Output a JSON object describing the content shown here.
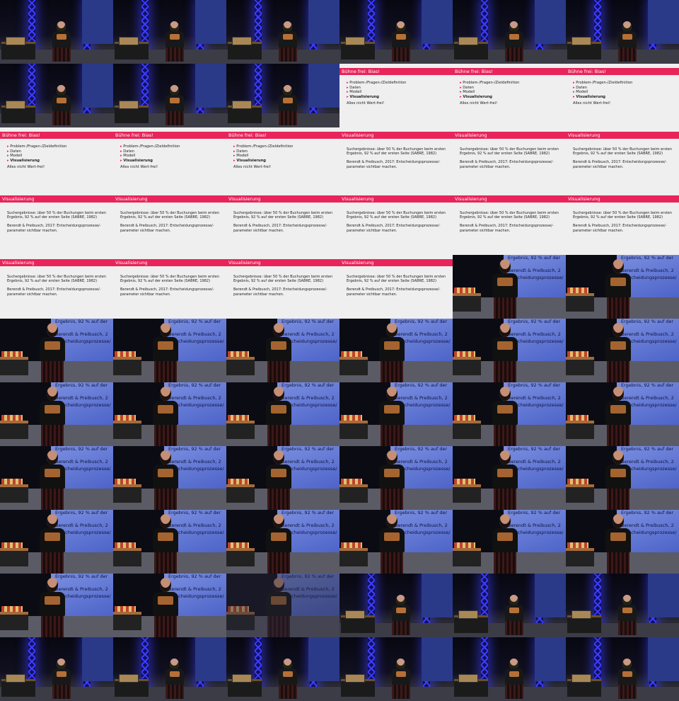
{
  "slide_types": {
    "bias": {
      "title": "Bühne frei: Bias!",
      "items": [
        "Problem-/Fragen-/Zieldefinition",
        "Daten",
        "Modell",
        "Visualisierung"
      ],
      "bold_item": "Visualisierung",
      "footer_text": "Alles nicht Wert-frei!"
    },
    "viz": {
      "title": "Visualisierung",
      "para1": "Suchergebnisse: über 50 % der Buchungen beim ersten Ergebnis, 92 % auf der ersten Seite (SABRE, 1982)",
      "para2": "Berendt & Preibusch, 2017: Entscheidungsprozesse/-parameter sichtbar machen."
    },
    "zoom": {
      "line1": "Ergebnis, 92 % auf der",
      "line2": "Berendt & Preibusch, 2",
      "line3": "Entscheidungsprozesse/"
    }
  },
  "frames": [
    "stage",
    "stage",
    "stage",
    "stage",
    "stage",
    "stage",
    "stage",
    "stage",
    "stage",
    "bias",
    "bias",
    "bias",
    "bias",
    "bias",
    "bias",
    "viz",
    "viz",
    "viz",
    "viz",
    "viz",
    "viz",
    "viz",
    "viz",
    "viz",
    "viz",
    "viz",
    "viz",
    "viz",
    "zoom",
    "zoom",
    "zoom",
    "zoom",
    "zoom",
    "zoom",
    "zoom",
    "zoom",
    "zoom",
    "zoom",
    "zoom",
    "zoom",
    "zoom",
    "zoom",
    "zoom",
    "zoom",
    "zoom",
    "zoom",
    "zoom",
    "zoom",
    "zoom",
    "zoom",
    "zoom",
    "zoom",
    "zoom",
    "zoom",
    "zoom",
    "zoom",
    "zoom-dim",
    "stage",
    "stage",
    "stage",
    "stage",
    "stage",
    "stage",
    "stage",
    "stage",
    "stage"
  ],
  "colors": {
    "slide_bar": "#e8245a",
    "truss_light": "#3c3cff",
    "projection": "#5f74d4"
  }
}
